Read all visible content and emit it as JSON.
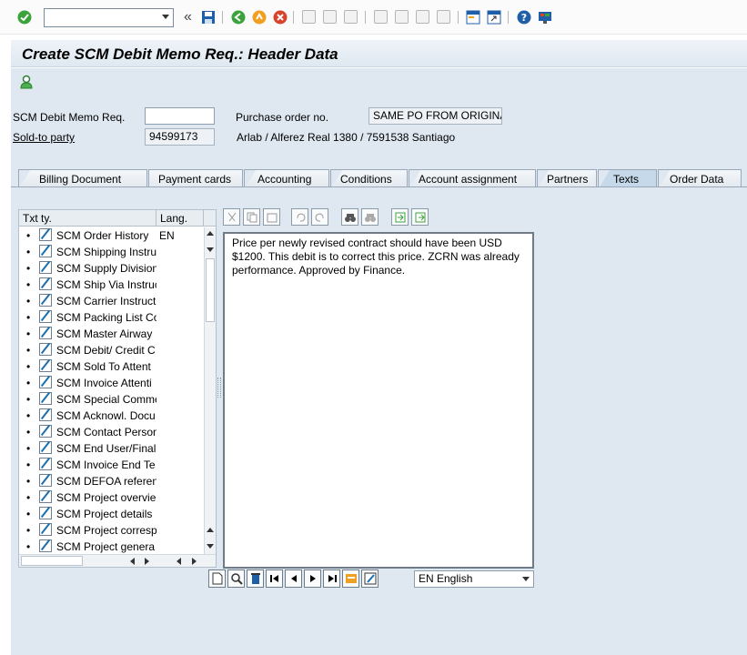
{
  "toolbar": {
    "command_value": "",
    "back_glyph": "«"
  },
  "header": {
    "title": "Create SCM Debit Memo Req.: Header Data"
  },
  "fields": {
    "debit_memo_label": "SCM Debit Memo Req.",
    "debit_memo_value": "",
    "po_label": "Purchase order no.",
    "po_value": "SAME PO FROM ORIGINA",
    "sold_to_label": "Sold-to party",
    "sold_to_value": "94599173",
    "sold_to_desc": "Arlab / Alferez Real 1380 / 7591538 Santiago"
  },
  "tabs": [
    {
      "label": "Billing Document"
    },
    {
      "label": "Payment cards"
    },
    {
      "label": "Accounting"
    },
    {
      "label": "Conditions"
    },
    {
      "label": "Account assignment"
    },
    {
      "label": "Partners"
    },
    {
      "label": "Texts"
    },
    {
      "label": "Order Data"
    }
  ],
  "active_tab": "Texts",
  "text_list": {
    "col_type": "Txt ty.",
    "col_lang": "Lang.",
    "rows": [
      {
        "name": "SCM Order History",
        "lang": "EN"
      },
      {
        "name": "SCM Shipping Instru",
        "lang": ""
      },
      {
        "name": "SCM Supply Division",
        "lang": ""
      },
      {
        "name": "SCM Ship Via Instruc",
        "lang": ""
      },
      {
        "name": "SCM Carrier Instruct",
        "lang": ""
      },
      {
        "name": "SCM Packing List Co",
        "lang": ""
      },
      {
        "name": "SCM Master Airway",
        "lang": ""
      },
      {
        "name": "SCM Debit/ Credit C",
        "lang": ""
      },
      {
        "name": "SCM Sold To Attent",
        "lang": ""
      },
      {
        "name": "SCM Invoice Attenti",
        "lang": ""
      },
      {
        "name": "SCM Special Comme",
        "lang": ""
      },
      {
        "name": "SCM Acknowl. Docu",
        "lang": ""
      },
      {
        "name": "SCM Contact Person",
        "lang": ""
      },
      {
        "name": "SCM End User/Final",
        "lang": ""
      },
      {
        "name": "SCM Invoice End Te",
        "lang": ""
      },
      {
        "name": "SCM DEFOA referen",
        "lang": ""
      },
      {
        "name": "SCM Project overvie",
        "lang": ""
      },
      {
        "name": "SCM Project details",
        "lang": ""
      },
      {
        "name": "SCM Project corresp",
        "lang": ""
      },
      {
        "name": "SCM Project genera",
        "lang": ""
      }
    ]
  },
  "editor": {
    "text": "Price per newly revised contract should have been USD $1200. This debit is to correct this price. ZCRN was already performance. Approved by Finance."
  },
  "language_select": {
    "value": "EN English"
  },
  "colors": {
    "title_bg": "#dfe8f1",
    "active_tab": "#c5d9ea",
    "ok_green": "#3ca33c"
  }
}
